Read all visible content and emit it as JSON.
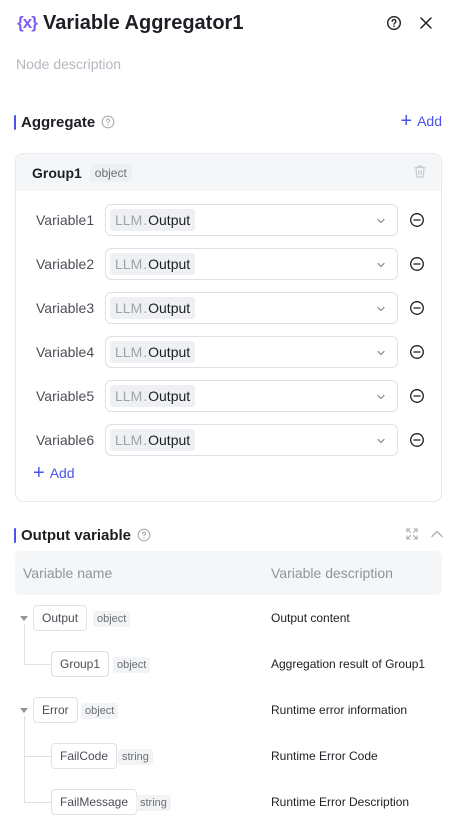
{
  "header": {
    "icon": "{x}",
    "title": "Variable Aggregator1",
    "description_placeholder": "Node description"
  },
  "aggregate": {
    "title": "Aggregate",
    "add_label": "Add",
    "group": {
      "name": "Group1",
      "type": "object",
      "variables": [
        {
          "label": "Variable1",
          "source": "LLM",
          "sep": ".",
          "output": "Output"
        },
        {
          "label": "Variable2",
          "source": "LLM",
          "sep": ".",
          "output": "Output"
        },
        {
          "label": "Variable3",
          "source": "LLM",
          "sep": ".",
          "output": "Output"
        },
        {
          "label": "Variable4",
          "source": "LLM",
          "sep": ".",
          "output": "Output"
        },
        {
          "label": "Variable5",
          "source": "LLM",
          "sep": ".",
          "output": "Output"
        },
        {
          "label": "Variable6",
          "source": "LLM",
          "sep": ".",
          "output": "Output"
        }
      ],
      "add_label": "Add"
    }
  },
  "output": {
    "title": "Output variable",
    "columns": [
      "Variable name",
      "Variable description"
    ],
    "rows": [
      {
        "name": "Output",
        "type": "object",
        "description": "Output content"
      },
      {
        "name": "Group1",
        "type": "object",
        "description": "Aggregation result of Group1"
      },
      {
        "name": "Error",
        "type": "object",
        "description": "Runtime error information"
      },
      {
        "name": "FailCode",
        "type": "string",
        "description": "Runtime Error Code"
      },
      {
        "name": "FailMessage",
        "type": "string",
        "description": "Runtime Error Description"
      }
    ]
  },
  "colors": {
    "accent": "#4d53e8",
    "icon_purple": "#7b5cf5"
  },
  "icons": [
    "variable-node-icon",
    "help-icon",
    "close-icon",
    "info-icon",
    "plus-icon",
    "trash-icon",
    "chevron-down-icon",
    "minus-circle-icon",
    "expand-icon",
    "chevron-up-icon",
    "caret-down-icon"
  ]
}
